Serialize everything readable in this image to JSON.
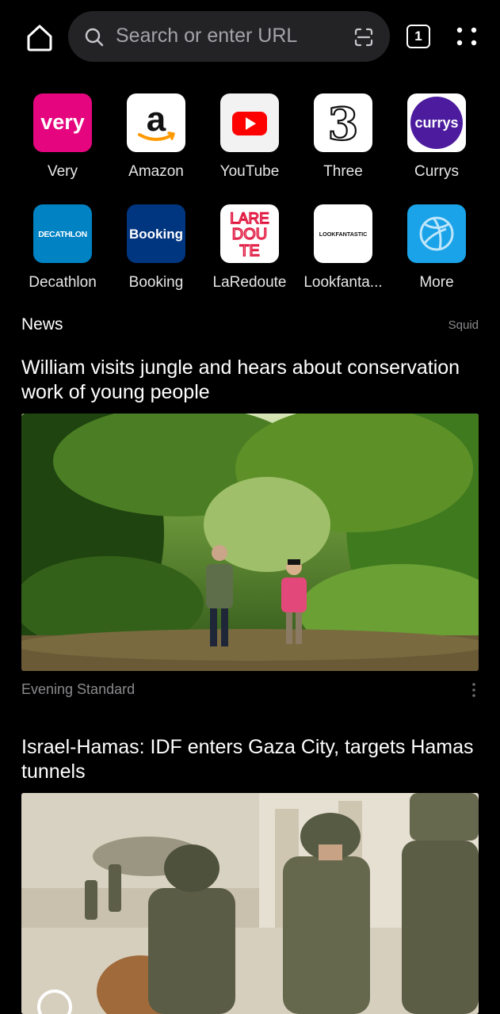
{
  "search": {
    "placeholder": "Search or enter URL"
  },
  "tabs": {
    "count": "1"
  },
  "shortcuts": [
    {
      "label": "Very",
      "icon": "very-logo-icon",
      "bg": "#e5067f"
    },
    {
      "label": "Amazon",
      "icon": "amazon-logo-icon",
      "bg": "#ffffff"
    },
    {
      "label": "YouTube",
      "icon": "youtube-logo-icon",
      "bg": "#f2f2f2"
    },
    {
      "label": "Three",
      "icon": "three-logo-icon",
      "bg": "#ffffff"
    },
    {
      "label": "Currys",
      "icon": "currys-logo-icon",
      "bg": "#ffffff"
    },
    {
      "label": "Decathlon",
      "icon": "decathlon-logo-icon",
      "bg": "#0082c3"
    },
    {
      "label": "Booking",
      "icon": "booking-logo-icon",
      "bg": "#003580"
    },
    {
      "label": "LaRedoute",
      "icon": "laredoute-logo-icon",
      "bg": "#ffffff"
    },
    {
      "label": "Lookfanta...",
      "icon": "lookfantastic-logo-icon",
      "bg": "#ffffff"
    },
    {
      "label": "More",
      "icon": "globe-icon",
      "bg": "#1aa3e8"
    }
  ],
  "logo_text": {
    "very": "very",
    "amazon": "a",
    "three": "3",
    "currys": "currys",
    "decathlon": "DECATHLON",
    "booking": "Booking",
    "laredoute": [
      "LARE",
      "DOU",
      "TE"
    ],
    "lookfantastic": "LOOKFANTASTIC"
  },
  "news": {
    "header": "News",
    "provider": "Squid",
    "articles": [
      {
        "title": "William visits jungle and hears about conservation work of young people",
        "source": "Evening Standard"
      },
      {
        "title": "Israel-Hamas: IDF enters Gaza City, targets Hamas tunnels",
        "source": ""
      }
    ]
  },
  "colors": {
    "background": "#000000",
    "search_bg": "#232325",
    "muted_text": "#8a8a8e"
  }
}
